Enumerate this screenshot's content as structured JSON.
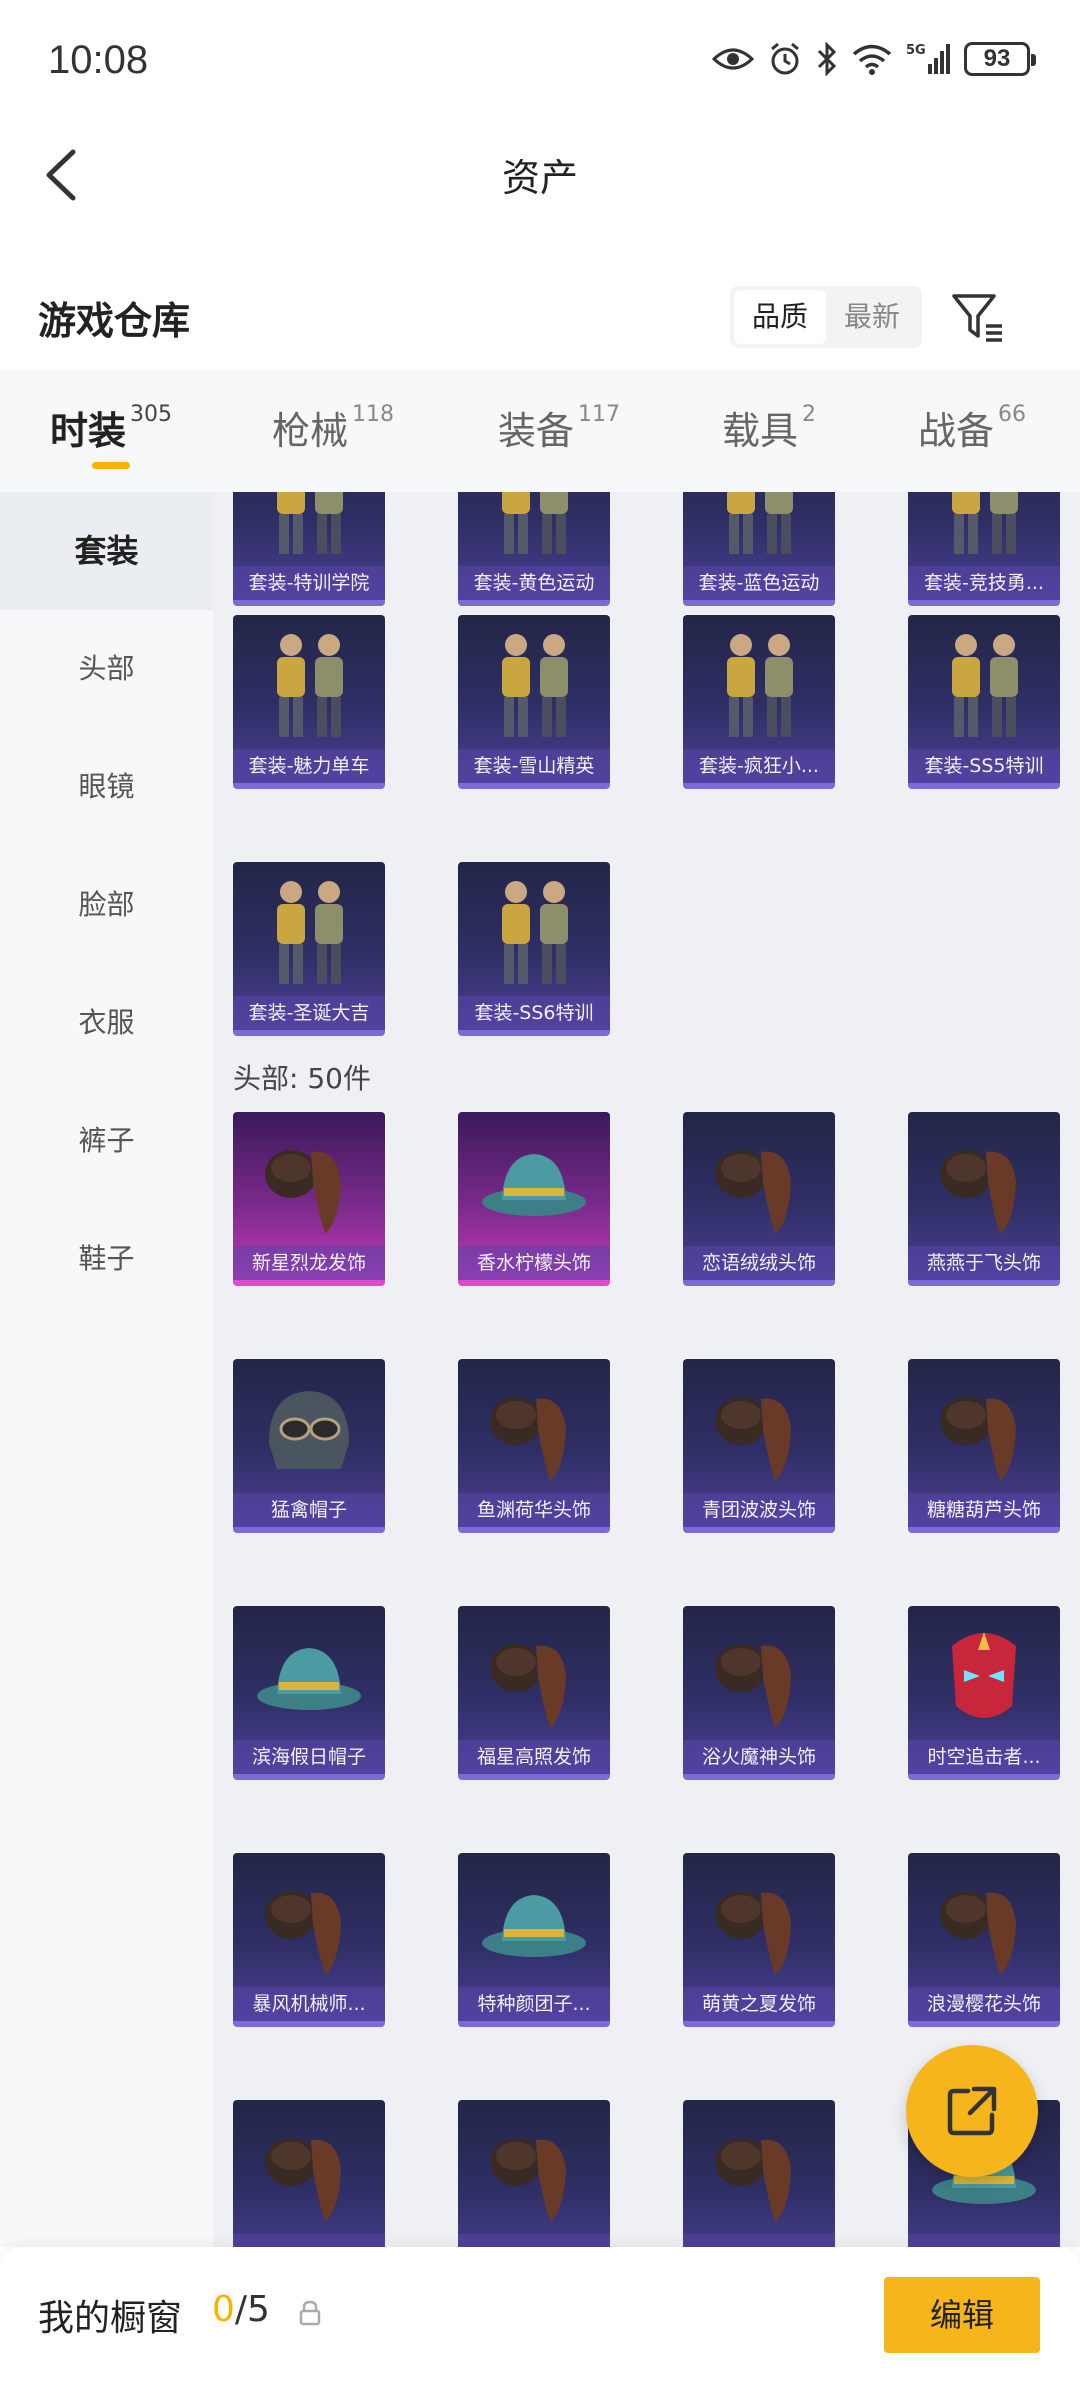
{
  "status_bar": {
    "time": "10:08",
    "network": "5G",
    "battery": "93"
  },
  "nav": {
    "title": "资产"
  },
  "section": {
    "title": "游戏仓库"
  },
  "sort_options": [
    {
      "label": "品质",
      "active": true
    },
    {
      "label": "最新",
      "active": false
    }
  ],
  "tabs": [
    {
      "label": "时装",
      "count": "305",
      "active": true
    },
    {
      "label": "枪械",
      "count": "118",
      "active": false
    },
    {
      "label": "装备",
      "count": "117",
      "active": false
    },
    {
      "label": "载具",
      "count": "2",
      "active": false
    },
    {
      "label": "战备",
      "count": "66",
      "active": false
    }
  ],
  "side_menu": [
    {
      "label": "套装",
      "active": true
    },
    {
      "label": "头部",
      "active": false
    },
    {
      "label": "眼镜",
      "active": false
    },
    {
      "label": "脸部",
      "active": false
    },
    {
      "label": "衣服",
      "active": false
    },
    {
      "label": "裤子",
      "active": false
    },
    {
      "label": "鞋子",
      "active": false
    }
  ],
  "suits": [
    {
      "label": "套装-特训学院",
      "icon": "outfit-icon"
    },
    {
      "label": "套装-黄色运动",
      "icon": "outfit-icon"
    },
    {
      "label": "套装-蓝色运动",
      "icon": "outfit-icon"
    },
    {
      "label": "套装-竞技勇...",
      "icon": "outfit-icon"
    },
    {
      "label": "套装-魅力单车",
      "icon": "outfit-icon"
    },
    {
      "label": "套装-雪山精英",
      "icon": "outfit-icon"
    },
    {
      "label": "套装-疯狂小...",
      "icon": "outfit-icon"
    },
    {
      "label": "套装-SS5特训",
      "icon": "outfit-icon"
    },
    {
      "label": "套装-圣诞大吉",
      "icon": "outfit-icon"
    },
    {
      "label": "套装-SS6特训",
      "icon": "outfit-icon"
    }
  ],
  "head_group_label": "头部: 50件",
  "head_items": [
    {
      "label": "新星烈龙发饰",
      "icon": "hair-icon",
      "rarity": "pink"
    },
    {
      "label": "香水柠檬头饰",
      "icon": "hat-icon",
      "rarity": "pink"
    },
    {
      "label": "恋语绒绒头饰",
      "icon": "hair-icon",
      "rarity": "purple"
    },
    {
      "label": "燕燕于飞头饰",
      "icon": "hair-icon",
      "rarity": "purple"
    },
    {
      "label": "猛禽帽子",
      "icon": "helmet-icon",
      "rarity": "purple"
    },
    {
      "label": "鱼渊荷华头饰",
      "icon": "hair-icon",
      "rarity": "purple"
    },
    {
      "label": "青团波波头饰",
      "icon": "hair-icon",
      "rarity": "purple"
    },
    {
      "label": "糖糖葫芦头饰",
      "icon": "hair-icon",
      "rarity": "purple"
    },
    {
      "label": "滨海假日帽子",
      "icon": "hat-icon",
      "rarity": "purple"
    },
    {
      "label": "福星高照发饰",
      "icon": "hair-icon",
      "rarity": "purple"
    },
    {
      "label": "浴火魔神头饰",
      "icon": "hair-icon",
      "rarity": "purple"
    },
    {
      "label": "时空追击者...",
      "icon": "mask-icon",
      "rarity": "purple"
    },
    {
      "label": "暴风机械师...",
      "icon": "hair-icon",
      "rarity": "purple"
    },
    {
      "label": "特种颜团子...",
      "icon": "hat-icon",
      "rarity": "purple"
    },
    {
      "label": "萌黄之夏发饰",
      "icon": "hair-icon",
      "rarity": "purple"
    },
    {
      "label": "浪漫樱花头饰",
      "icon": "hair-icon",
      "rarity": "purple"
    },
    {
      "label": "",
      "icon": "hair-icon",
      "rarity": "purple"
    },
    {
      "label": "",
      "icon": "hair-icon",
      "rarity": "purple"
    },
    {
      "label": "",
      "icon": "hair-icon",
      "rarity": "purple"
    },
    {
      "label": "",
      "icon": "hat-icon",
      "rarity": "purple"
    }
  ],
  "bottom_bar": {
    "label": "我的橱窗",
    "current": "0",
    "total": "/5",
    "edit_label": "编辑"
  },
  "colors": {
    "accent": "#f6b61b",
    "card_purple": "#4b3f94",
    "card_pink": "#c23ab8"
  }
}
